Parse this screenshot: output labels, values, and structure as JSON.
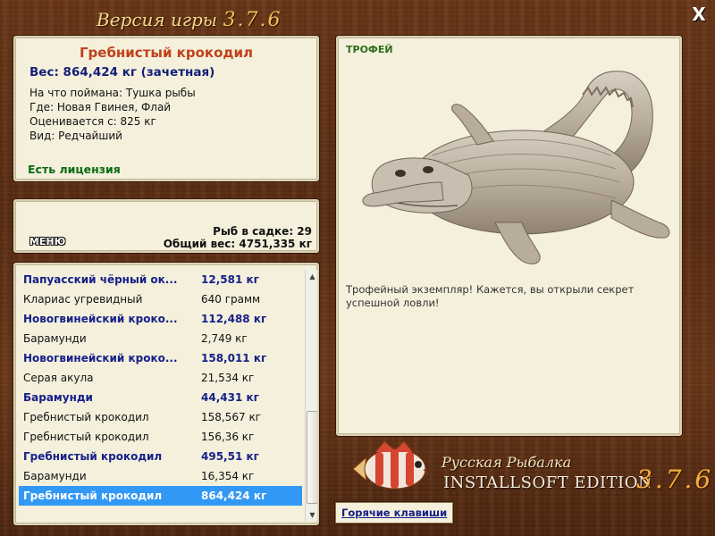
{
  "header": {
    "title_prefix": "Версия игры",
    "version": "3.7.6",
    "close_label": "X"
  },
  "catch": {
    "name": "Гребнистый крокодил",
    "weight": "Вес: 864,424 кг (зачетная)",
    "bait": "На что поймана: Тушка рыбы",
    "location": "Где: Новая Гвинея, Флай",
    "threshold": "Оценивается с: 825 кг",
    "rarity": "Вид: Редчайший",
    "license": "Есть лицензия"
  },
  "summary": {
    "menu_label": "МЕНЮ",
    "fish_in_keepnet": "Рыб в садке: 29",
    "total_weight": "Общий вес: 4751,335 кг"
  },
  "list": {
    "rows": [
      {
        "name": "Папуасский чёрный ок...",
        "weight": "12,581 кг",
        "trophy": true
      },
      {
        "name": "Клариас угревидный",
        "weight": "640 грамм",
        "trophy": false
      },
      {
        "name": "Новогвинейский кроко...",
        "weight": "112,488 кг",
        "trophy": true
      },
      {
        "name": "Барамунди",
        "weight": "2,749 кг",
        "trophy": false
      },
      {
        "name": "Новогвинейский кроко...",
        "weight": "158,011 кг",
        "trophy": true
      },
      {
        "name": "Серая акула",
        "weight": "21,534 кг",
        "trophy": false
      },
      {
        "name": "Барамунди",
        "weight": "44,431 кг",
        "trophy": true
      },
      {
        "name": "Гребнистый крокодил",
        "weight": "158,567 кг",
        "trophy": false
      },
      {
        "name": "Гребнистый крокодил",
        "weight": "156,36 кг",
        "trophy": false
      },
      {
        "name": "Гребнистый крокодил",
        "weight": "495,51 кг",
        "trophy": true
      },
      {
        "name": "Барамунди",
        "weight": "16,354 кг",
        "trophy": false
      },
      {
        "name": "Гребнистый крокодил",
        "weight": "864,424 кг",
        "trophy": true,
        "selected": true
      }
    ]
  },
  "trophy": {
    "label": "ТРОФЕЙ",
    "message": "Трофейный экземпляр! Кажется, вы открыли секрет успешной ловли!"
  },
  "logo": {
    "line1": "Русская Рыбалка",
    "line2": "INSTALLSOFT EDITION",
    "version": "3.7.6"
  },
  "footer": {
    "hotkeys_label": "Горячие клавиши"
  },
  "colors": {
    "background_wood": "#5a2c12",
    "panel": "#f4f0dc",
    "trophy_text": "#16208a",
    "selection": "#3298f5",
    "fish_name": "#c0401a",
    "license": "#0a6a12"
  }
}
